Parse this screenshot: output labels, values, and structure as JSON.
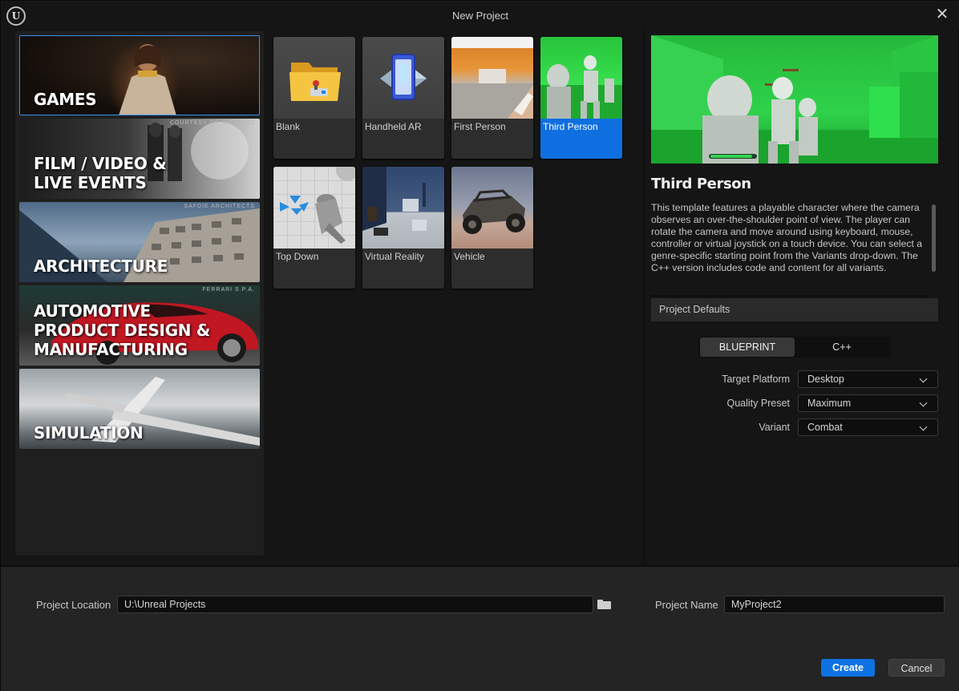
{
  "window": {
    "title": "New Project",
    "close_glyph": "✕",
    "logo_text": "U"
  },
  "categories": [
    {
      "label": "GAMES",
      "credit": "",
      "selected": true
    },
    {
      "label": "FILM / VIDEO &\nLIVE EVENTS",
      "credit": "COURTESY OF HIGH RES"
    },
    {
      "label": "ARCHITECTURE",
      "credit": "SAFDIE ARCHITECTS"
    },
    {
      "label": "AUTOMOTIVE\nPRODUCT DESIGN &\nMANUFACTURING",
      "credit": "FERRARI S.P.A."
    },
    {
      "label": "SIMULATION",
      "credit": ""
    }
  ],
  "templates": [
    {
      "label": "Blank"
    },
    {
      "label": "Handheld AR"
    },
    {
      "label": "First Person"
    },
    {
      "label": "Third Person",
      "selected": true
    },
    {
      "label": "Top Down"
    },
    {
      "label": "Virtual Reality"
    },
    {
      "label": "Vehicle"
    }
  ],
  "details": {
    "title": "Third Person",
    "description": "This template features a playable character where the camera observes an over-the-shoulder point of view. The player can rotate the camera and move around using keyboard, mouse, controller or virtual joystick on a touch device. You can select a genre-specific starting point from the Variants drop-down. The C++ version includes code and content for all variants.",
    "defaults_header": "Project Defaults",
    "mode": {
      "blueprint": "BLUEPRINT",
      "cpp": "C++",
      "selected": "BLUEPRINT"
    },
    "properties": [
      {
        "label": "Target Platform",
        "value": "Desktop"
      },
      {
        "label": "Quality Preset",
        "value": "Maximum"
      },
      {
        "label": "Variant",
        "value": "Combat"
      }
    ]
  },
  "footer": {
    "location_label": "Project Location",
    "location_value": "U:\\Unreal Projects",
    "name_label": "Project Name",
    "name_value": "MyProject2",
    "create_label": "Create",
    "cancel_label": "Cancel"
  },
  "colors": {
    "accent": "#0f72e3",
    "selection": "#0f6fe0",
    "background": "#151515"
  }
}
